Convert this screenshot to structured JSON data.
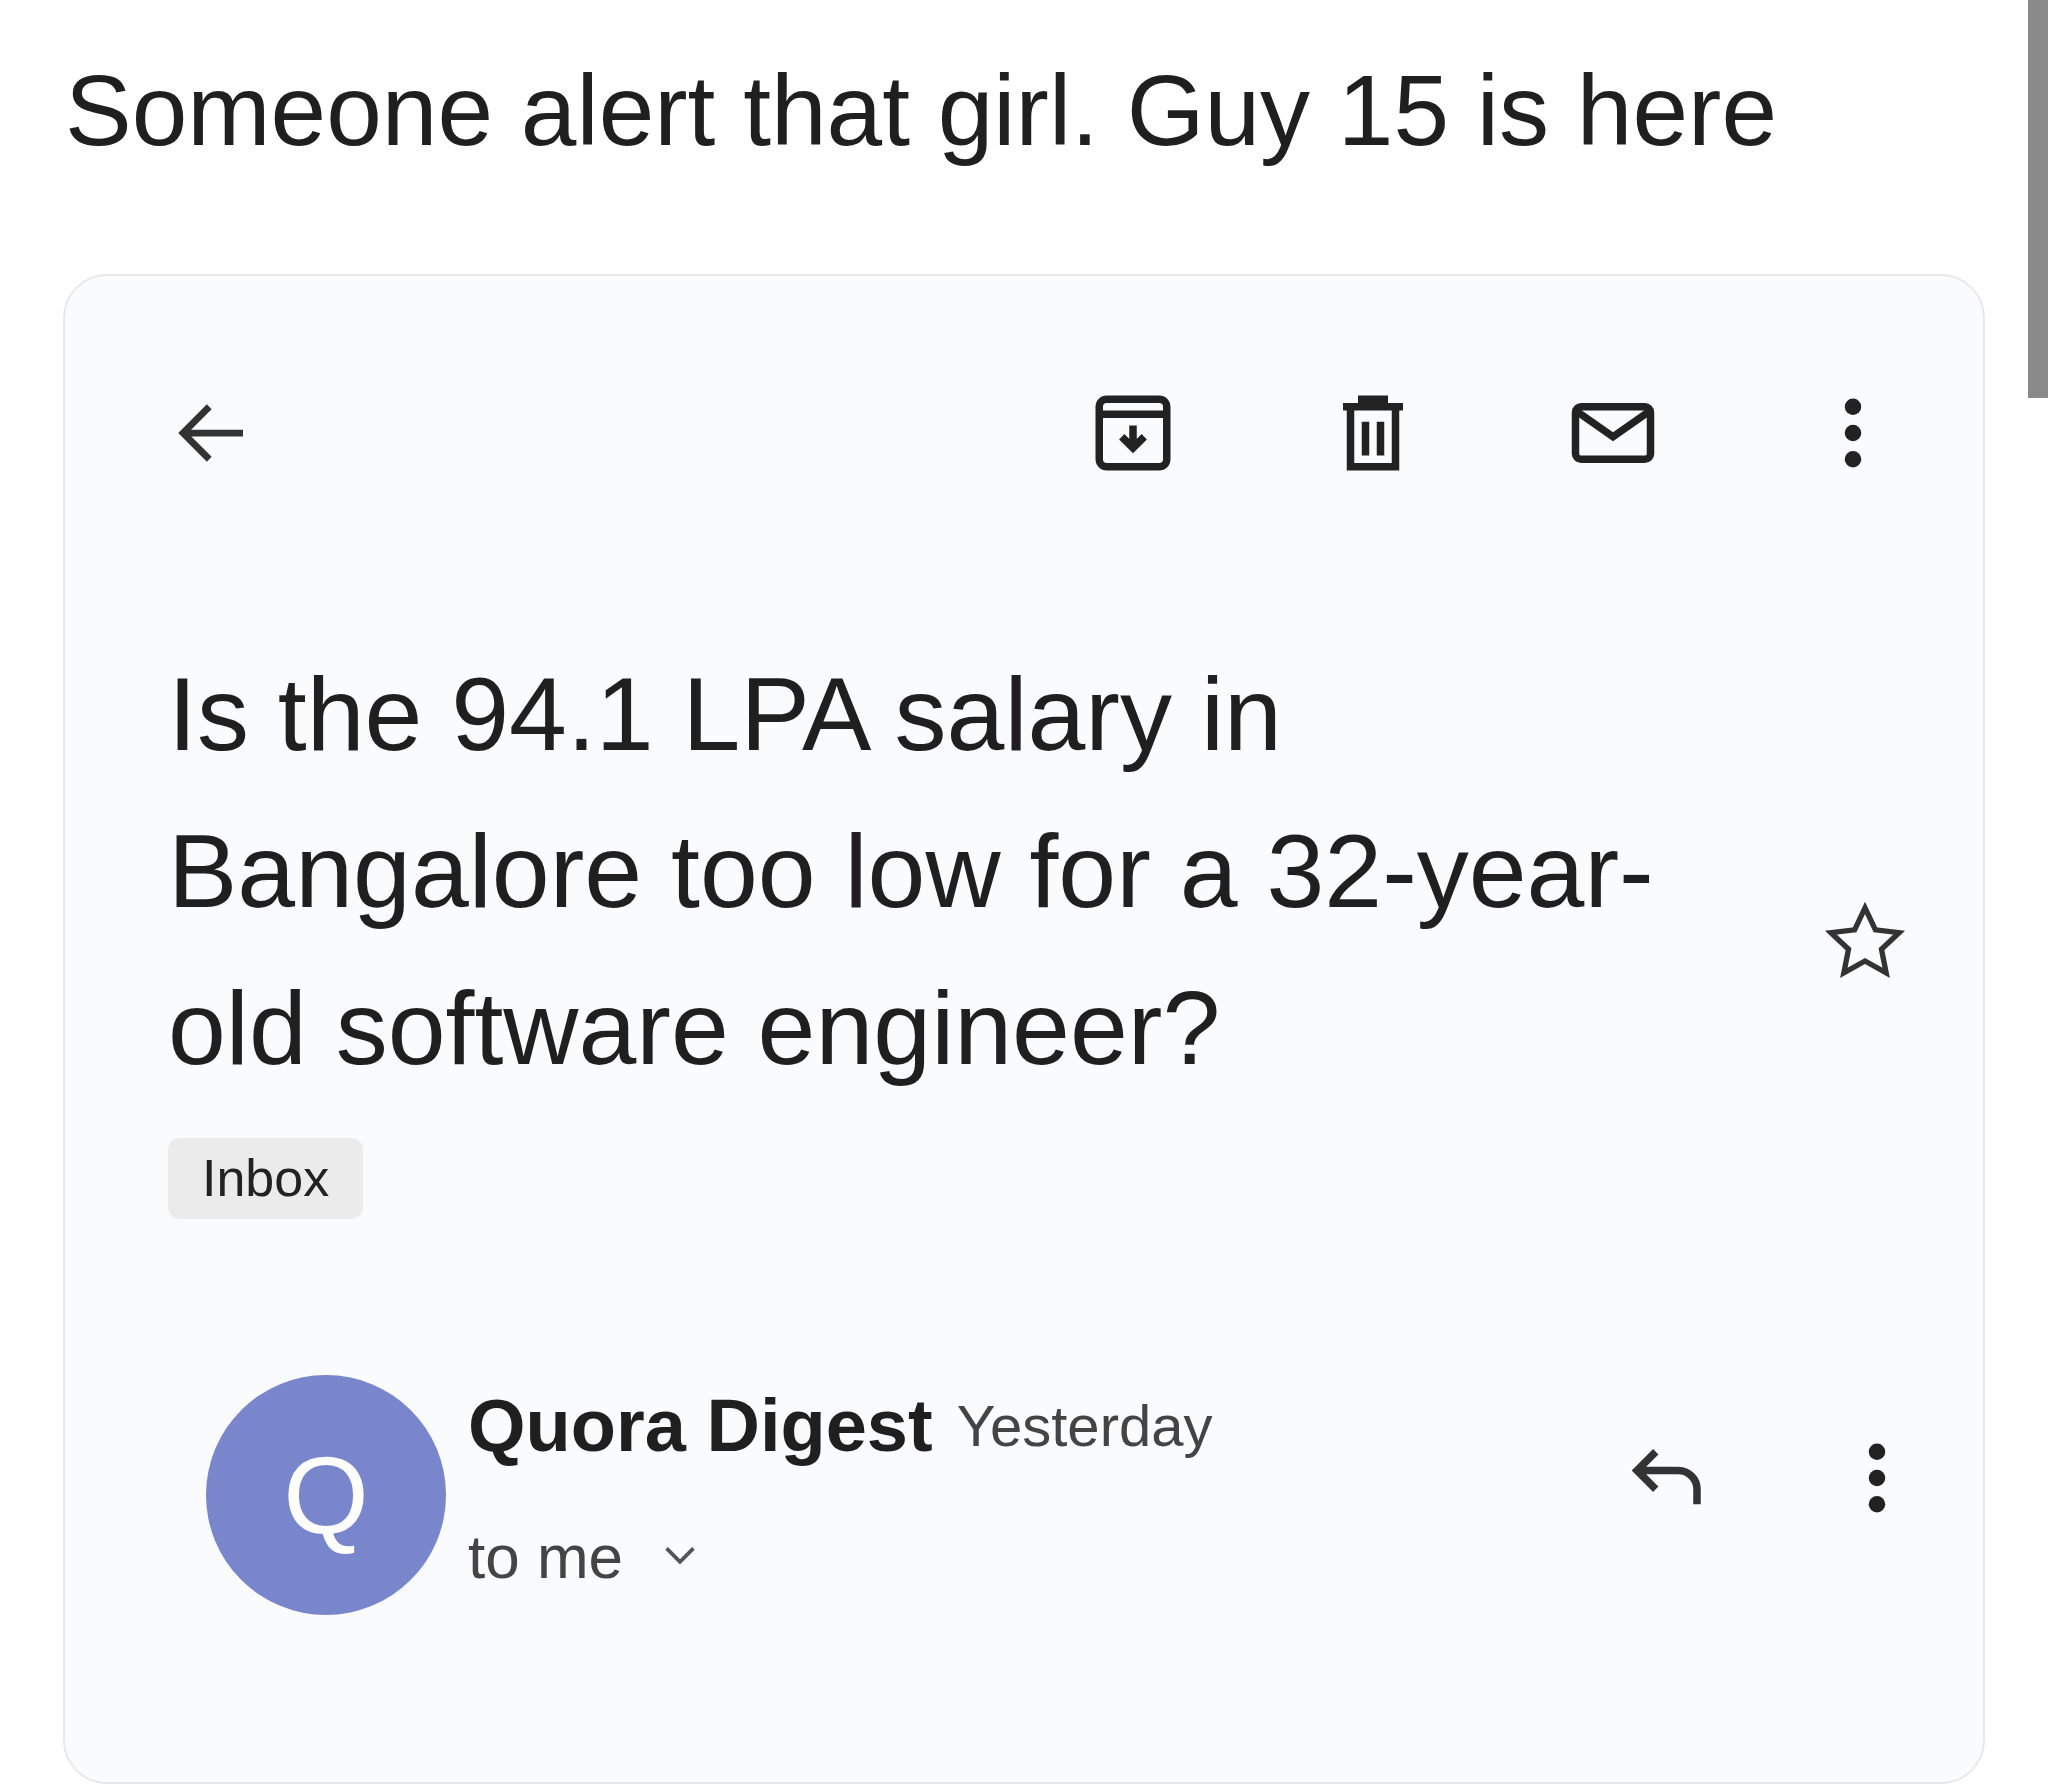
{
  "post": {
    "text": "Someone alert that girl. Guy 15 is here"
  },
  "email": {
    "subject": "Is the 94.1 LPA salary in Bangalore too low for a 32-year-old software engineer?",
    "starred": false,
    "labels": [
      "Inbox"
    ],
    "sender": {
      "initial": "Q",
      "name": "Quora Digest",
      "time": "Yesterday",
      "recipient": "to me"
    }
  }
}
